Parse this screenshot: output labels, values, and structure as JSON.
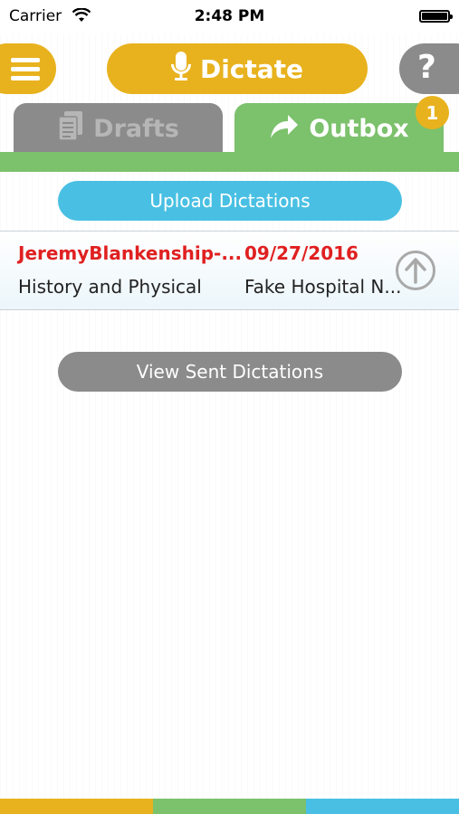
{
  "status": {
    "carrier": "Carrier",
    "time": "2:48 PM"
  },
  "header": {
    "dictate_label": "Dictate",
    "help_label": "?"
  },
  "tabs": {
    "drafts_label": "Drafts",
    "outbox_label": "Outbox",
    "outbox_badge": "1"
  },
  "actions": {
    "upload_label": "Upload Dictations",
    "view_sent_label": "View Sent Dictations"
  },
  "dictations": [
    {
      "name": "JeremyBlankenship-...",
      "date": "09/27/2016",
      "type": "History and Physical",
      "facility": "Fake Hospital N..."
    }
  ],
  "colors": {
    "yellow": "#e8b21e",
    "green": "#7cc16c",
    "blue": "#49c0e3",
    "gray": "#8b8b8b",
    "red": "#e02020"
  },
  "icons": {
    "menu": "hamburger-icon",
    "mic": "microphone-icon",
    "drafts": "document-icon",
    "outbox": "share-arrow-icon",
    "upload": "upload-arrow-icon"
  }
}
